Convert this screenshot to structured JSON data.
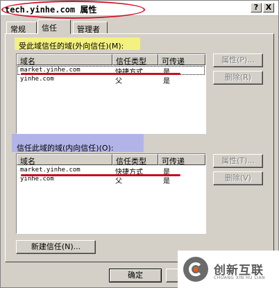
{
  "window": {
    "title": "tech.yinhe.com 属性",
    "help_glyph": "?",
    "close_glyph": "X"
  },
  "tabs": [
    {
      "label": "常规"
    },
    {
      "label": "信任"
    },
    {
      "label": "管理者"
    }
  ],
  "outgoing": {
    "label": "受此域信任的域(外向信任)(M):",
    "columns": [
      "域名",
      "信任类型",
      "可传递"
    ],
    "rows": [
      {
        "name": "market.yinhe.com",
        "type": "快捷方式",
        "transitive": "是"
      },
      {
        "name": "yinhe.com",
        "type": "父",
        "transitive": "是"
      }
    ],
    "properties_label": "属性(P)...",
    "remove_label": "删除(R)"
  },
  "incoming": {
    "label": "信任此域的域(内向信任)(O):",
    "columns": [
      "域名",
      "信任类型",
      "可传递"
    ],
    "rows": [
      {
        "name": "market.yinhe.com",
        "type": "快捷方式",
        "transitive": "是"
      },
      {
        "name": "yinhe.com",
        "type": "父",
        "transitive": "是"
      }
    ],
    "properties_label": "属性(T)...",
    "remove_label": "删除(V)"
  },
  "footer": {
    "new_trust_label": "新建信任(N)...",
    "ok_label": "确定",
    "cancel_label": ""
  },
  "watermark": {
    "logo_icon": "chuangxin-logo-icon",
    "text": "创新互联",
    "subtext": "CHUANG XIN HU LIAN"
  },
  "colors": {
    "annotation_red": "#c4101e",
    "highlight_yellow": "#f3f180",
    "highlight_purple": "#b2b4e8",
    "dialog_gray": "#d4d0c8"
  }
}
